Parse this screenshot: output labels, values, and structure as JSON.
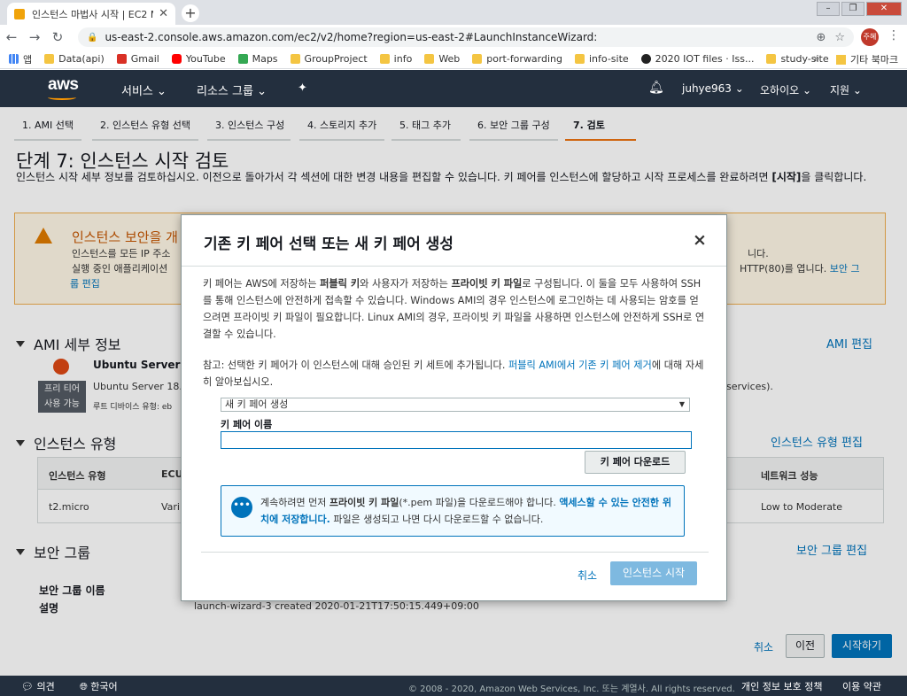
{
  "browser": {
    "tab_title": "인스턴스 마법사 시작 | EC2 Ma",
    "url": "us-east-2.console.aws.amazon.com/ec2/v2/home?region=us-east-2#LaunchInstanceWizard:",
    "profile_label": "주혜",
    "bookmarks": [
      "앱",
      "Data(api)",
      "Gmail",
      "YouTube",
      "Maps",
      "GroupProject",
      "info",
      "Web",
      "port-forwarding",
      "info-site",
      "2020 IOT files · Iss...",
      "study-site"
    ],
    "bookmark_more": "»",
    "other_bookmarks": "기타 북마크"
  },
  "aws_header": {
    "logo": "aws",
    "services": "서비스",
    "resource_groups": "리소스 그룹",
    "user": "juhye963",
    "region": "오하이오",
    "support": "지원"
  },
  "steps": [
    "1. AMI 선택",
    "2. 인스턴스 유형 선택",
    "3. 인스턴스 구성",
    "4. 스토리지 추가",
    "5. 태그 추가",
    "6. 보안 그룹 구성",
    "7. 검토"
  ],
  "page": {
    "title": "단계 7: 인스턴스 시작 검토",
    "desc_part1": "인스턴스 시작 세부 정보를 검토하십시오. 이전으로 돌아가서 각 섹션에 대한 변경 내용을 편집할 수 있습니다. 키 페어를 인스턴스에 할당하고 시작 프로세스를 완료하려면 ",
    "desc_bold": "[시작]",
    "desc_part2": "을 클릭합니다.",
    "warning_title": "인스턴스 보안을 개",
    "warning_line1": "인스턴스를 모든 IP 주소",
    "warning_line2": "실행 중인 애플리케이션",
    "warning_line3": "룹 편집",
    "warning_right1": "니다.",
    "warning_right2": "HTTP(80)를 엽니다.",
    "warning_right2_link": "보안 그",
    "ami_section": "AMI 세부 정보",
    "ami_edit": "AMI 편집",
    "ubuntu_title": "Ubuntu Server 1",
    "ubuntu_sub": "Ubuntu Server 18.0",
    "ubuntu_sub2": "루트 디바이스 유형: eb",
    "free_tier_1": "프리 티어",
    "free_tier_2": "사용 가능",
    "ubuntu_right": "services).",
    "instance_section": "인스턴스 유형",
    "instance_edit": "인스턴스 유형 편집",
    "table_headers": {
      "type": "인스턴스 유형",
      "ecu": "ECU",
      "network": "네트워크 성능"
    },
    "table_row": {
      "type": "t2.micro",
      "ecu": "Vari",
      "network": "Low to Moderate"
    },
    "sg_section": "보안 그룹",
    "sg_edit": "보안 그룹 편집",
    "sg_name_label": "보안 그룹 이름",
    "sg_desc_label": "설명",
    "sg_desc_value": "launch-wizard-3 created 2020-01-21T17:50:15.449+09:00",
    "cancel": "취소",
    "prev": "이전",
    "launch": "시작하기"
  },
  "footer": {
    "feedback": "의견",
    "language": "한국어",
    "copyright": "© 2008 - 2020, Amazon Web Services, Inc. 또는 계열사. All rights reserved.",
    "privacy": "개인 정보 보호 정책",
    "terms": "이용 약관"
  },
  "modal": {
    "title": "기존 키 페어 선택 또는 새 키 페어 생성",
    "close": "×",
    "p1_a": "키 페어는 AWS에 저장하는 ",
    "p1_b": "퍼블릭 키",
    "p1_c": "와 사용자가 저장하는 ",
    "p1_d": "프라이빗 키 파일",
    "p1_e": "로 구성됩니다. 이 둘을 모두 사용하여 SSH를 통해 인스턴스에 안전하게 접속할 수 있습니다. Windows AMI의 경우 인스턴스에 로그인하는 데 사용되는 암호를 얻으려면 프라이빗 키 파일이 필요합니다. Linux AMI의 경우, 프라이빗 키 파일을 사용하면 인스턴스에 안전하게 SSH로 연결할 수 있습니다.",
    "p2_a": "참고: 선택한 키 페어가 이 인스턴스에 대해 승인된 키 세트에 추가됩니다. ",
    "p2_link": "퍼블릭 AMI에서 기존 키 페어 제거",
    "p2_b": "에 대해 자세히 알아보십시오.",
    "select_value": "새 키 페어 생성",
    "keypair_label": "키 페어 이름",
    "keypair_value": "",
    "download_btn": "키 페어 다운로드",
    "info_a": "계속하려면 먼저 ",
    "info_b": "프라이빗 키 파일",
    "info_c": "(*.pem 파일)을 다운로드해야 합니다. ",
    "info_d": "액세스할 수 있는 안전한 위치에 저장합니다.",
    "info_e": " 파일은 생성되고 나면 다시 다운로드할 수 없습니다.",
    "cancel": "취소",
    "launch": "인스턴스 시작"
  }
}
